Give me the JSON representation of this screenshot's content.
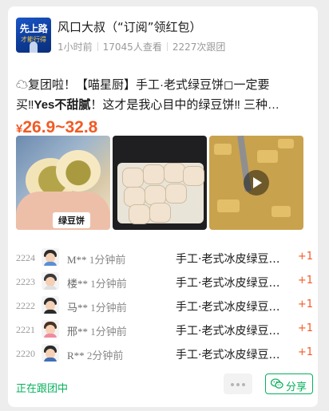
{
  "header": {
    "logo_text": "先上路",
    "logo_sub": "才能行得",
    "account_name": "风口大叔（“订阅”领红包）",
    "time_ago": "1小时前",
    "views": "17045人查看",
    "followers": "2227次跟团"
  },
  "post": {
    "title_line1": "☁复团啦！【喵星厨】手工·老式绿豆饼◻一定要",
    "title_line2_prefix": "买‼",
    "title_line2_bold": "Yes不甜腻",
    "title_line2_suffix": "！这才是我心目中的绿豆饼‼ 三种…",
    "price_currency": "¥",
    "price_range": "26.9~32.8",
    "image1_tag": "绿豆饼"
  },
  "orders": [
    {
      "no": "2224",
      "buyer": "M**",
      "time": "1分钟前",
      "product": "手工·老式冰皮绿豆…",
      "qty": "+1"
    },
    {
      "no": "2223",
      "buyer": "楼**",
      "time": "1分钟前",
      "product": "手工·老式冰皮绿豆…",
      "qty": "+1"
    },
    {
      "no": "2222",
      "buyer": "马**",
      "time": "1分钟前",
      "product": "手工·老式冰皮绿豆…",
      "qty": "+1"
    },
    {
      "no": "2221",
      "buyer": "邢**",
      "time": "1分钟前",
      "product": "手工·老式冰皮绿豆…",
      "qty": "+1"
    },
    {
      "no": "2220",
      "buyer": "R**",
      "time": "2分钟前",
      "product": "手工·老式冰皮绿豆…",
      "qty": "+1"
    }
  ],
  "footer": {
    "status": "正在跟团中",
    "share_label": "分享"
  },
  "colors": {
    "accent_orange": "#f25a24",
    "wechat_green": "#07b15c"
  },
  "icons": {
    "more": "more-dots-icon",
    "share": "wechat-icon",
    "play": "play-icon"
  }
}
